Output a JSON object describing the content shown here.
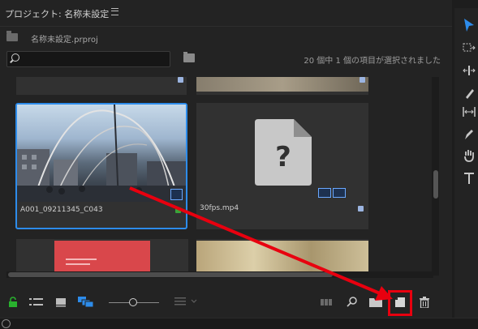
{
  "panel": {
    "title": "プロジェクト: 名称未設定",
    "project_file": "名称未設定.prproj",
    "status_text": "20 個中 1 個の項目が選択されました"
  },
  "items": [
    {
      "name": "A001_09211345_C043",
      "selected": true,
      "type": "video",
      "label_color": "#3aa43a"
    },
    {
      "name": "30fps.mp4",
      "selected": false,
      "type": "missing",
      "label_color": "#9bb4e0"
    }
  ],
  "icons": {
    "tab_menu": "menu-icon",
    "project": "folder-icon",
    "search": "search-icon",
    "new_bin_search": "bin-search-icon",
    "lock": "lock-icon",
    "list_view": "list-view-icon",
    "icon_view": "icon-view-icon",
    "freeform_view": "freeform-view-icon",
    "zoom_slider": "zoom-slider",
    "sort": "sort-icon",
    "automate_sequence": "automate-icon",
    "find": "find-icon",
    "new_bin": "new-bin-icon",
    "new_item": "new-item-icon",
    "delete": "trash-icon"
  },
  "colors": {
    "accent_selection": "#2d8ceb",
    "highlight": "#e8000f",
    "lock_green": "#29b12e",
    "view_blue": "#2d8ceb"
  }
}
